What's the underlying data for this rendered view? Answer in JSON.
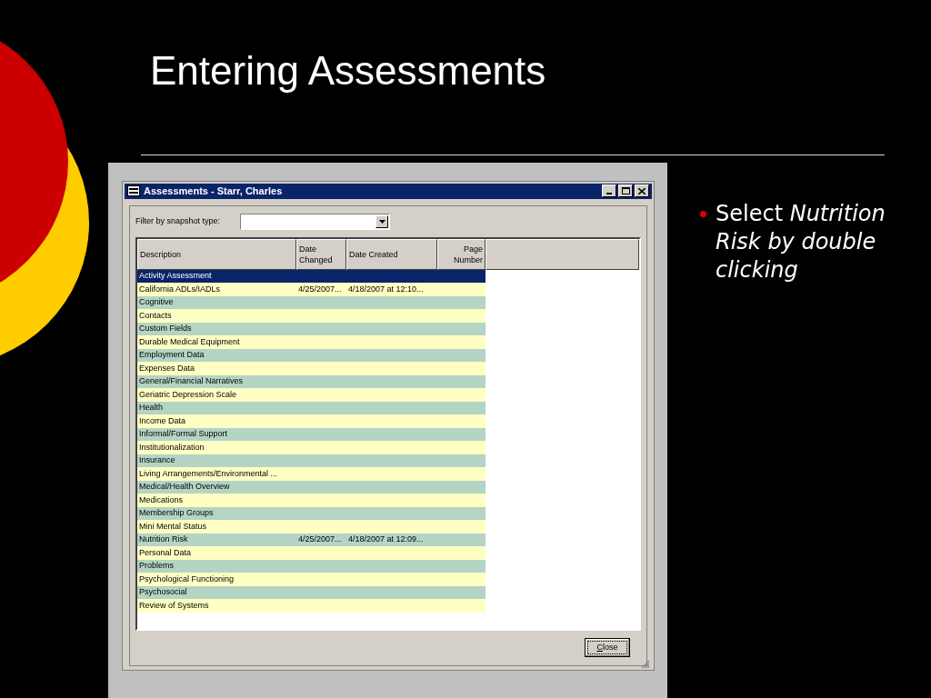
{
  "slide": {
    "title": "Entering Assessments",
    "bullet": "Select *Nutrition Risk by double clicking*"
  },
  "window": {
    "title": "Assessments - Starr, Charles",
    "filter_label": "Filter by snapshot type:",
    "columns": [
      {
        "label": "Description"
      },
      {
        "label": "Date Changed"
      },
      {
        "label": "Date Created"
      },
      {
        "label": "Page Number"
      }
    ],
    "rows": [
      {
        "description": "Activity Assessment",
        "selected": true
      },
      {
        "description": "California ADLs/IADLs",
        "date_changed": "4/25/2007...",
        "date_created": "4/18/2007 at 12:10...",
        "selected": false
      },
      {
        "description": "Cognitive",
        "selected": false
      },
      {
        "description": "Contacts",
        "selected": false
      },
      {
        "description": "Custom Fields",
        "selected": false
      },
      {
        "description": "Durable Medical Equipment",
        "selected": false
      },
      {
        "description": "Employment Data",
        "selected": false
      },
      {
        "description": "Expenses Data",
        "selected": false
      },
      {
        "description": "General/Financial Narratives",
        "selected": false
      },
      {
        "description": "Geriatric Depression Scale",
        "selected": false
      },
      {
        "description": "Health",
        "selected": false
      },
      {
        "description": "Income Data",
        "selected": false
      },
      {
        "description": "Informal/Formal Support",
        "selected": false
      },
      {
        "description": "Institutionalization",
        "selected": false
      },
      {
        "description": "Insurance",
        "selected": false
      },
      {
        "description": "Living Arrangements/Environmental ...",
        "selected": false
      },
      {
        "description": "Medical/Health Overview",
        "selected": false
      },
      {
        "description": "Medications",
        "selected": false
      },
      {
        "description": "Membership Groups",
        "selected": false
      },
      {
        "description": "Mini Mental Status",
        "selected": false
      },
      {
        "description": "Nutrition Risk",
        "date_changed": "4/25/2007...",
        "date_created": "4/18/2007 at 12:09...",
        "selected": false
      },
      {
        "description": "Personal Data",
        "selected": false
      },
      {
        "description": "Problems",
        "selected": false
      },
      {
        "description": "Psychological Functioning",
        "selected": false
      },
      {
        "description": "Psychosocial",
        "selected": false
      },
      {
        "description": "Review of Systems",
        "selected": false
      }
    ],
    "close_button": "Close"
  }
}
